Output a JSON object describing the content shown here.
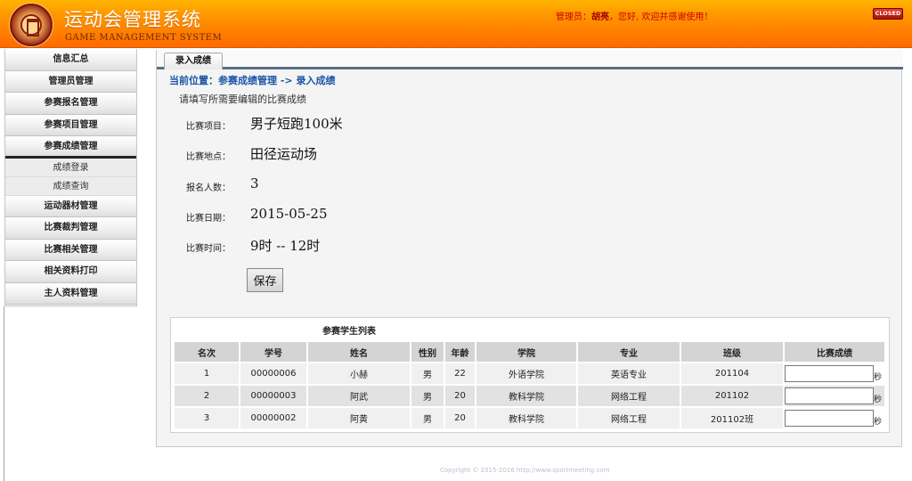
{
  "header": {
    "title": "运动会管理系统",
    "subtitle": "GAME MANAGEMENT SYSTEM",
    "admin_label": "管理员：",
    "admin_name": "胡亮",
    "welcome": "，您好, 欢迎并感谢使用！",
    "close_label": "CLOSED",
    "logo_icon": "university-seal-icon"
  },
  "sidebar": {
    "items": [
      {
        "label": "信息汇总"
      },
      {
        "label": "管理员管理"
      },
      {
        "label": "参赛报名管理"
      },
      {
        "label": "参赛项目管理"
      },
      {
        "label": "参赛成绩管理"
      }
    ],
    "subitems": [
      {
        "label": "成绩登录"
      },
      {
        "label": "成绩查询"
      }
    ],
    "items_after": [
      {
        "label": "运动器材管理"
      },
      {
        "label": "比赛裁判管理"
      },
      {
        "label": "比赛相关管理"
      },
      {
        "label": "相关资料打印"
      },
      {
        "label": "主人资料管理"
      }
    ]
  },
  "main": {
    "tab_label": "录入成绩",
    "breadcrumb": "当前位置：参赛成绩管理 -> 录入成绩",
    "hint": "请填写所需要编辑的比赛成绩",
    "form": {
      "event_label": "比赛项目：",
      "event_value": "男子短跑100米",
      "location_label": "比赛地点：",
      "location_value": "田径运动场",
      "count_label": "报名人数：",
      "count_value": "3",
      "date_label": "比赛日期：",
      "date_value": "2015-05-25",
      "time_label": "比赛时间：",
      "time_value": "9时  -- 12时"
    },
    "save_label": "保存",
    "table": {
      "caption": "参赛学生列表",
      "headers": [
        "名次",
        "学号",
        "姓名",
        "性别",
        "年龄",
        "学院",
        "专业",
        "班级",
        "比赛成绩"
      ],
      "rows": [
        {
          "rank": "1",
          "id": "00000006",
          "name": "小赫",
          "gender": "男",
          "age": "22",
          "college": "外语学院",
          "major": "英语专业",
          "class": "201104",
          "score": "",
          "unit": "秒"
        },
        {
          "rank": "2",
          "id": "00000003",
          "name": "阿武",
          "gender": "男",
          "age": "20",
          "college": "教科学院",
          "major": "网络工程",
          "class": "201102",
          "score": "",
          "unit": "秒"
        },
        {
          "rank": "3",
          "id": "00000002",
          "name": "阿黄",
          "gender": "男",
          "age": "20",
          "college": "教科学院",
          "major": "网络工程",
          "class": "201102班",
          "score": "",
          "unit": "秒"
        }
      ]
    }
  },
  "footer": {
    "copyright": "Copyright © 2015-2016 http://www.sportmeeting.com"
  },
  "colors": {
    "header_orange": "#ff8c00",
    "admin_red": "#cc0000",
    "breadcrumb_blue": "#1a55a8",
    "tab_border": "#5b6d83"
  }
}
